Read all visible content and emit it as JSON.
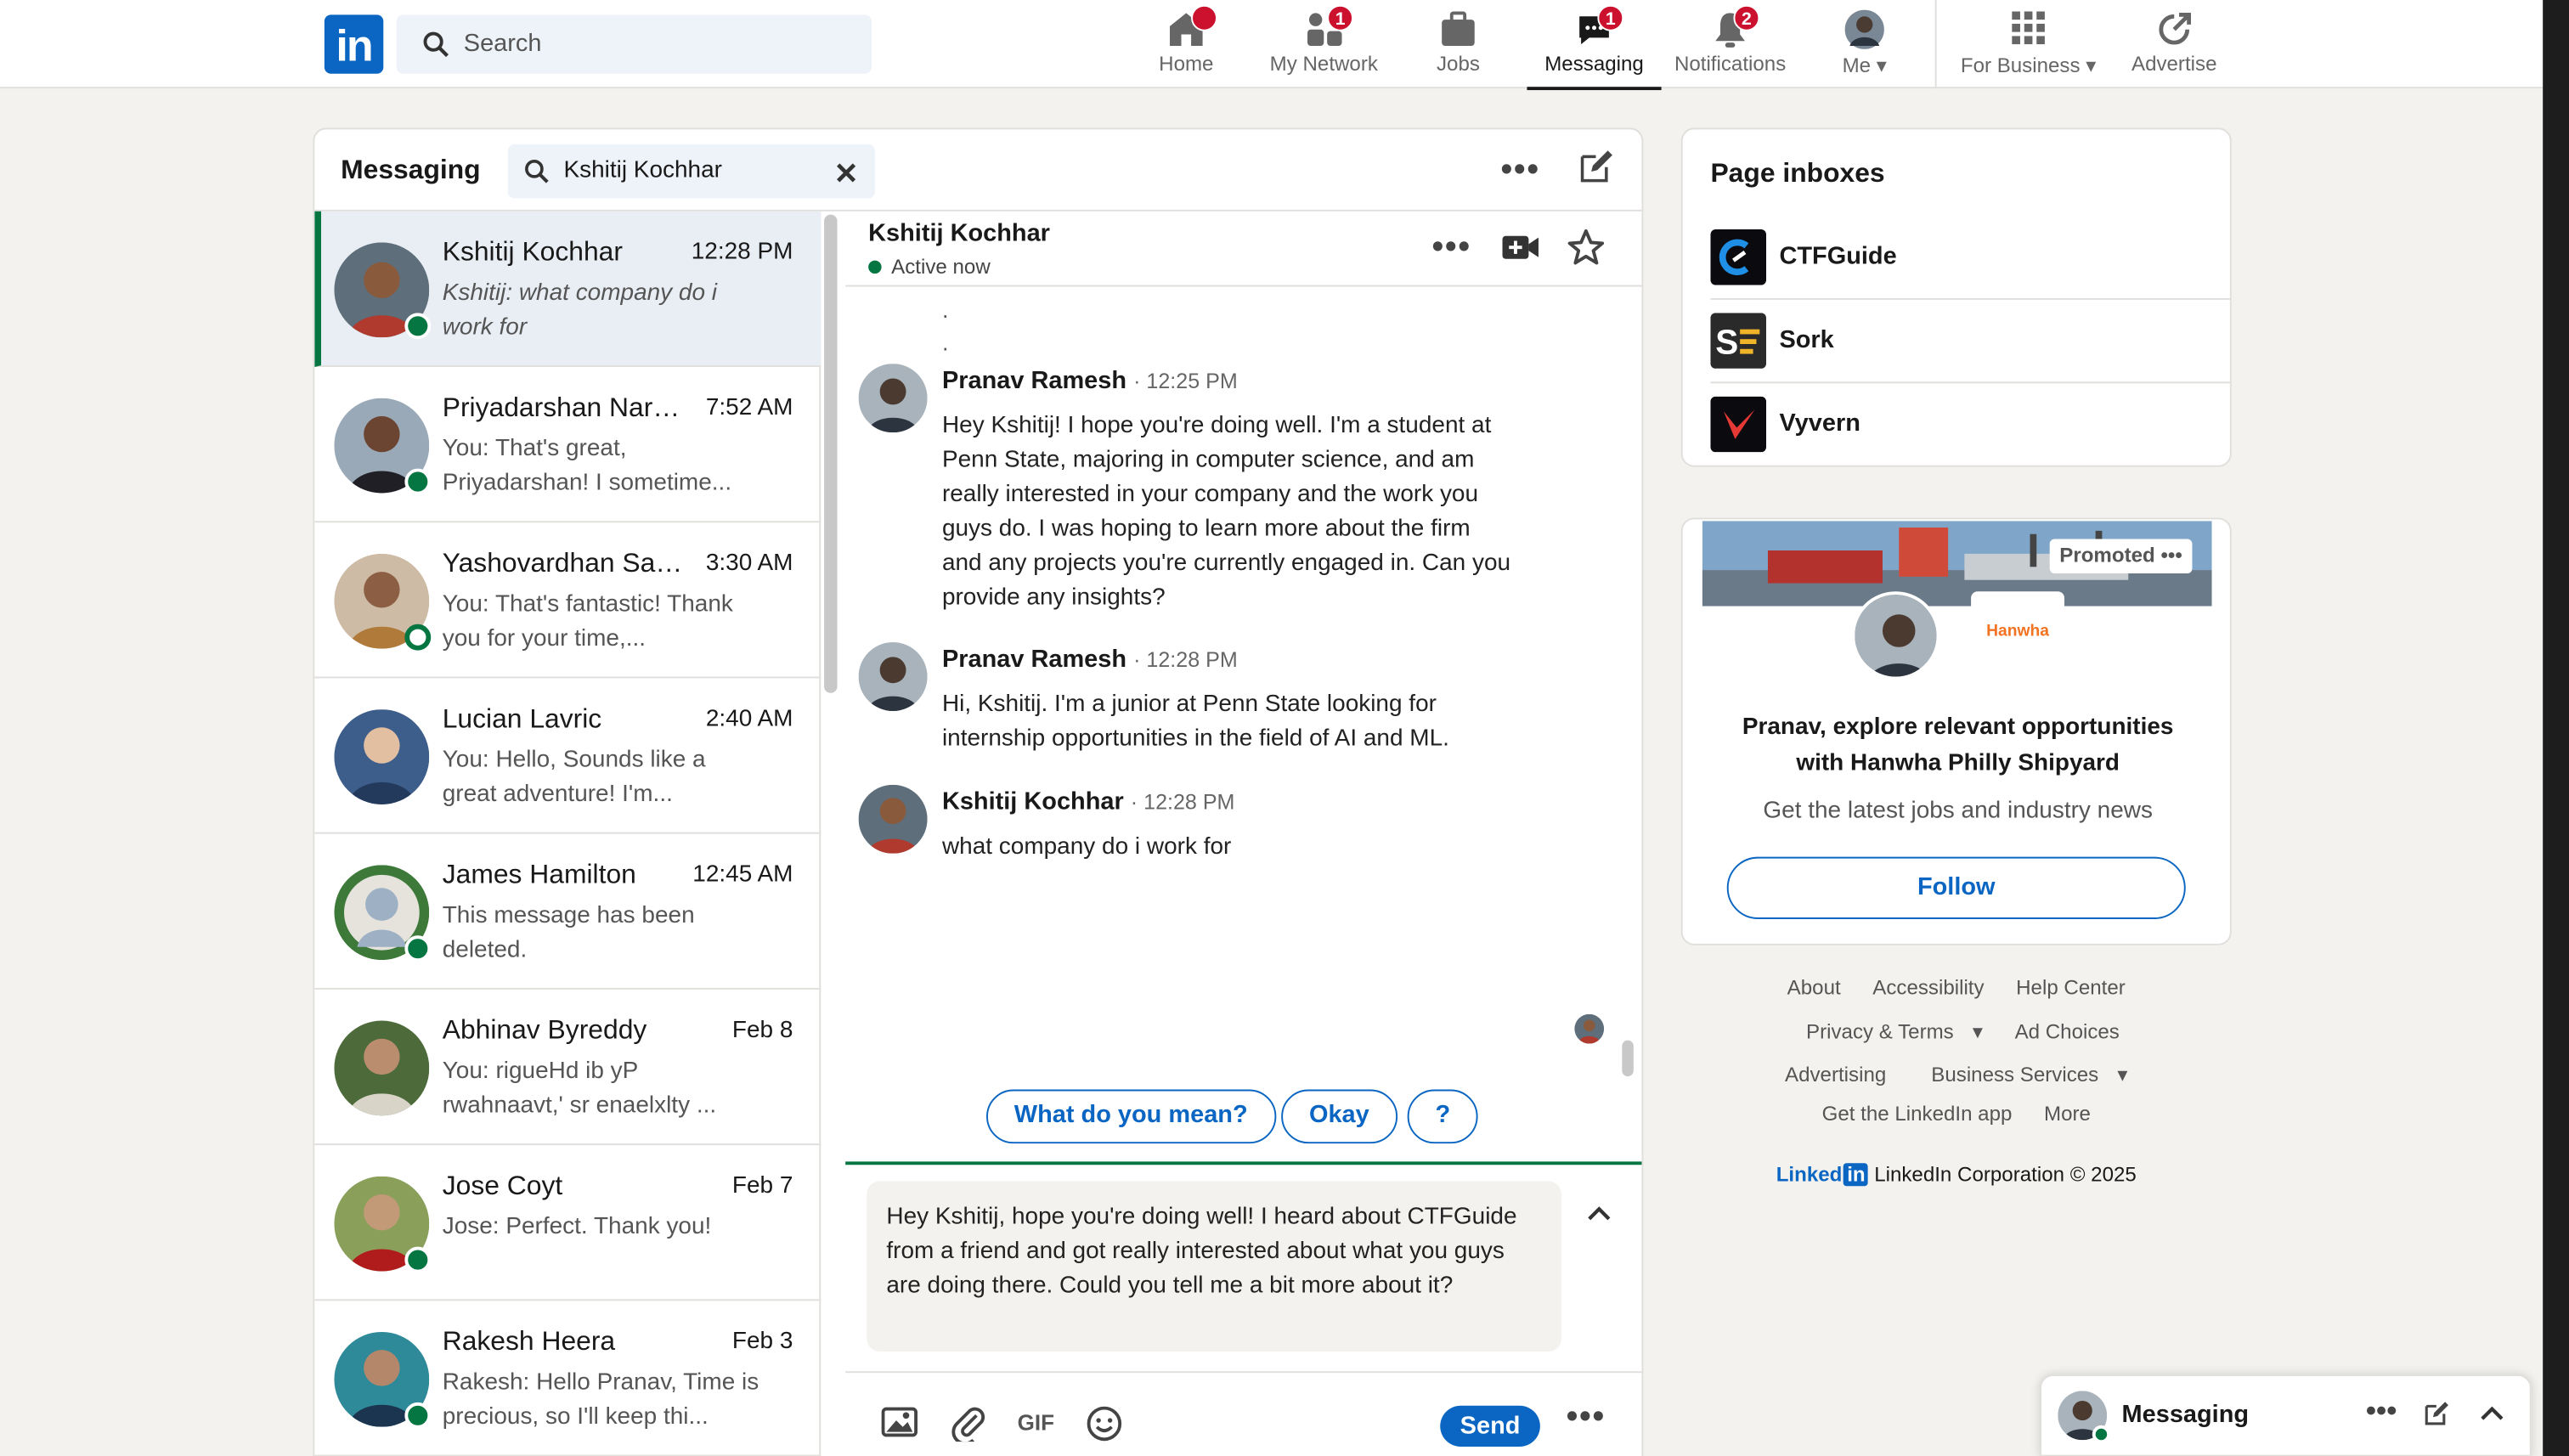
{
  "nav": {
    "search_placeholder": "Search",
    "items": [
      {
        "label": "Home",
        "badge": "",
        "icon": "home-icon"
      },
      {
        "label": "My Network",
        "badge": "1",
        "icon": "network-icon"
      },
      {
        "label": "Jobs",
        "badge": "",
        "icon": "briefcase-icon"
      },
      {
        "label": "Messaging",
        "badge": "1",
        "icon": "messaging-icon"
      },
      {
        "label": "Notifications",
        "badge": "2",
        "icon": "bell-icon"
      },
      {
        "label": "Me",
        "badge": "",
        "icon": "avatar"
      },
      {
        "label": "For Business",
        "badge": "",
        "icon": "grid-icon"
      },
      {
        "label": "Advertise",
        "badge": "",
        "icon": "advertise-icon"
      }
    ]
  },
  "messaging": {
    "title": "Messaging",
    "search_value": "Kshitij Kochhar",
    "conversations": [
      {
        "name": "Kshitij Kochhar",
        "time": "12:28 PM",
        "preview": "Kshitij: what company do i work for",
        "online": true
      },
      {
        "name": "Priyadarshan Narayanasamy",
        "time": "7:52 AM",
        "preview": "You: That's great, Priyadarshan! I sometime...",
        "online": true
      },
      {
        "name": "Yashovardhan Sardesai",
        "time": "3:30 AM",
        "preview": "You: That's fantastic! Thank you for your time,...",
        "online": true
      },
      {
        "name": "Lucian Lavric",
        "time": "2:40 AM",
        "preview": "You: Hello,  Sounds like a great adventure! I'm...",
        "online": false
      },
      {
        "name": "James Hamilton",
        "time": "12:45 AM",
        "preview": "This message has been deleted.",
        "online": true
      },
      {
        "name": "Abhinav Byreddy",
        "time": "Feb 8",
        "preview": "You: rigueHd ib yP rwahnaavt,' sr enaelxlty ...",
        "online": false
      },
      {
        "name": "Jose Coyt",
        "time": "Feb 7",
        "preview": "Jose: Perfect. Thank you!",
        "online": true
      },
      {
        "name": "Rakesh Heera",
        "time": "Feb 3",
        "preview": "Rakesh: Hello Pranav, Time is precious, so I'll keep thi...",
        "online": true
      }
    ]
  },
  "thread": {
    "name": "Kshitij Kochhar",
    "status": "Active now",
    "messages": [
      {
        "sender": "Pranav Ramesh",
        "time": "12:25 PM",
        "text": "Hey Kshitij! I hope you're doing well. I'm a student at Penn State, majoring in computer science, and am really interested in your company and the work you guys do. I was hoping to learn more about the firm and any projects you're currently engaged in. Can you provide any insights?"
      },
      {
        "sender": "Pranav Ramesh",
        "time": "12:28 PM",
        "text": "Hi, Kshitij. I'm a junior at Penn State looking for internship opportunities in the field of AI and ML."
      },
      {
        "sender": "Kshitij Kochhar",
        "time": "12:28 PM",
        "text": "what company do i work for"
      }
    ],
    "quick_replies": [
      "What do you mean?",
      "Okay",
      "?"
    ],
    "draft": "Hey Kshitij, hope you're doing well! I heard about CTFGuide from a friend and got really interested about what you guys are doing there. Could you tell me a bit more about it?",
    "gif_label": "GIF",
    "send_label": "Send"
  },
  "page_inboxes": {
    "title": "Page inboxes",
    "items": [
      {
        "name": "CTFGuide"
      },
      {
        "name": "Sork"
      },
      {
        "name": "Vyvern"
      }
    ]
  },
  "promo": {
    "tag": "Promoted",
    "company_logo_text": "Hanwha",
    "headline": "Pranav, explore relevant opportunities with Hanwha Philly Shipyard",
    "subtext": "Get the latest jobs and industry news",
    "follow_label": "Follow"
  },
  "footer": {
    "row1": [
      "About",
      "Accessibility",
      "Help Center"
    ],
    "row2": [
      "Privacy & Terms",
      "Ad Choices"
    ],
    "row3": [
      "Advertising",
      "Business Services"
    ],
    "row4": [
      "Get the LinkedIn app",
      "More"
    ],
    "brand": "Linked",
    "brand_in": "in",
    "copyright": "LinkedIn Corporation © 2025"
  },
  "popup": {
    "title": "Messaging"
  },
  "colors": {
    "brand": "#0a66c2",
    "online": "#057642",
    "badge": "#cb112d",
    "background": "#f4f2ee"
  }
}
